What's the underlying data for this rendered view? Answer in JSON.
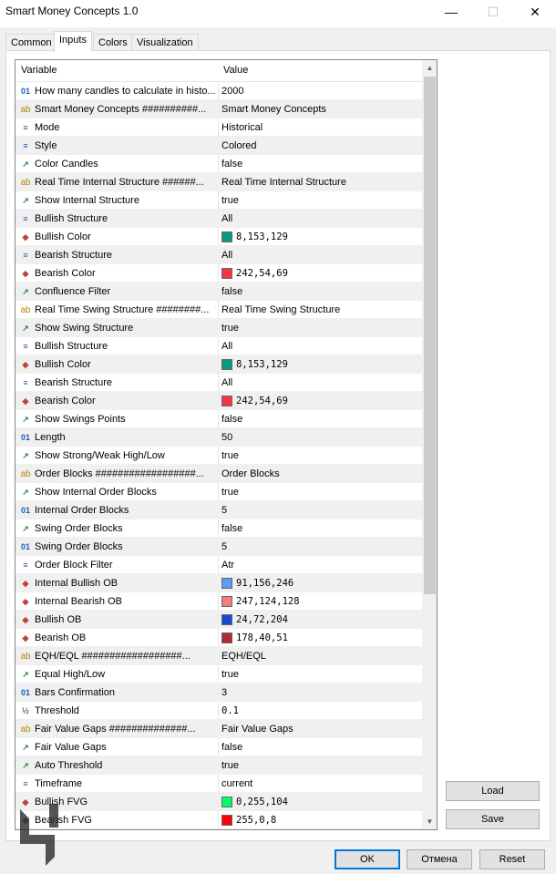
{
  "window": {
    "title": "Smart Money Concepts 1.0",
    "minimize": "—",
    "maximize": "☐",
    "close": "✕"
  },
  "tabs": [
    "Common",
    "Inputs",
    "Colors",
    "Visualization"
  ],
  "grid": {
    "col_variable": "Variable",
    "col_value": "Value",
    "rows": [
      {
        "icon": "01",
        "type": "num",
        "name": "How many candles to calculate in histo...",
        "value": "2000"
      },
      {
        "icon": "ab",
        "type": "str",
        "name": "Smart Money Concepts ##########...",
        "value": "Smart Money Concepts"
      },
      {
        "icon": "≡",
        "type": "enum",
        "name": "Mode",
        "value": "Historical"
      },
      {
        "icon": "≡",
        "type": "enum",
        "name": "Style",
        "value": "Colored"
      },
      {
        "icon": "↗",
        "type": "bool",
        "name": "Color Candles",
        "value": "false"
      },
      {
        "icon": "ab",
        "type": "str",
        "name": "Real Time Internal Structure ######...",
        "value": "Real Time Internal Structure"
      },
      {
        "icon": "↗",
        "type": "bool",
        "name": "Show Internal Structure",
        "value": "true"
      },
      {
        "icon": "≡",
        "type": "enum",
        "name": "Bullish Structure",
        "value": "All"
      },
      {
        "icon": "◆",
        "type": "color",
        "name": "Bullish Color",
        "value": "8,153,129",
        "swatch": "#089981"
      },
      {
        "icon": "≡",
        "type": "enum",
        "name": "Bearish Structure",
        "value": "All"
      },
      {
        "icon": "◆",
        "type": "color",
        "name": "Bearish Color",
        "value": "242,54,69",
        "swatch": "#f23645"
      },
      {
        "icon": "↗",
        "type": "bool",
        "name": "Confluence Filter",
        "value": "false"
      },
      {
        "icon": "ab",
        "type": "str",
        "name": "Real Time Swing Structure ########...",
        "value": "Real Time Swing Structure"
      },
      {
        "icon": "↗",
        "type": "bool",
        "name": "Show Swing Structure",
        "value": "true"
      },
      {
        "icon": "≡",
        "type": "enum",
        "name": "Bullish Structure",
        "value": "All"
      },
      {
        "icon": "◆",
        "type": "color",
        "name": "Bullish Color",
        "value": "8,153,129",
        "swatch": "#089981"
      },
      {
        "icon": "≡",
        "type": "enum",
        "name": "Bearish Structure",
        "value": "All"
      },
      {
        "icon": "◆",
        "type": "color",
        "name": "Bearish Color",
        "value": "242,54,69",
        "swatch": "#f23645"
      },
      {
        "icon": "↗",
        "type": "bool",
        "name": "Show Swings Points",
        "value": "false"
      },
      {
        "icon": "01",
        "type": "num",
        "name": "Length",
        "value": "50"
      },
      {
        "icon": "↗",
        "type": "bool",
        "name": "Show Strong/Weak High/Low",
        "value": "true"
      },
      {
        "icon": "ab",
        "type": "str",
        "name": "Order Blocks ##################...",
        "value": "Order Blocks"
      },
      {
        "icon": "↗",
        "type": "bool",
        "name": "Show Internal Order Blocks",
        "value": "true"
      },
      {
        "icon": "01",
        "type": "num",
        "name": "Internal Order Blocks",
        "value": "5"
      },
      {
        "icon": "↗",
        "type": "bool",
        "name": "Swing Order Blocks",
        "value": "false"
      },
      {
        "icon": "01",
        "type": "num",
        "name": "Swing Order Blocks",
        "value": "5"
      },
      {
        "icon": "≡",
        "type": "enum",
        "name": "Order Block Filter",
        "value": "Atr"
      },
      {
        "icon": "◆",
        "type": "color",
        "name": "Internal Bullish OB",
        "value": "91,156,246",
        "swatch": "#5b9cf6"
      },
      {
        "icon": "◆",
        "type": "color",
        "name": "Internal Bearish OB",
        "value": "247,124,128",
        "swatch": "#f77c80"
      },
      {
        "icon": "◆",
        "type": "color",
        "name": "Bullish OB",
        "value": "24,72,204",
        "swatch": "#1848cc"
      },
      {
        "icon": "◆",
        "type": "color",
        "name": "Bearish OB",
        "value": "178,40,51",
        "swatch": "#b22833"
      },
      {
        "icon": "ab",
        "type": "str",
        "name": "EQH/EQL ##################...",
        "value": "EQH/EQL"
      },
      {
        "icon": "↗",
        "type": "bool",
        "name": "Equal High/Low",
        "value": "true"
      },
      {
        "icon": "01",
        "type": "num",
        "name": "Bars Confirmation",
        "value": "3"
      },
      {
        "icon": "½",
        "type": "frac",
        "name": "Threshold",
        "value": "0.1"
      },
      {
        "icon": "ab",
        "type": "str",
        "name": "Fair Value Gaps ##############...",
        "value": "Fair Value Gaps"
      },
      {
        "icon": "↗",
        "type": "bool",
        "name": "Fair Value Gaps",
        "value": "false"
      },
      {
        "icon": "↗",
        "type": "bool",
        "name": "Auto Threshold",
        "value": "true"
      },
      {
        "icon": "≡",
        "type": "enum",
        "name": "Timeframe",
        "value": "current"
      },
      {
        "icon": "◆",
        "type": "color",
        "name": "Bullish FVG",
        "value": "0,255,104",
        "swatch": "#00ff68"
      },
      {
        "icon": "◆",
        "type": "color",
        "name": "Bearish FVG",
        "value": "255,0,8",
        "swatch": "#ff0008"
      }
    ]
  },
  "side_buttons": {
    "load": "Load",
    "save": "Save"
  },
  "footer_buttons": {
    "ok": "OK",
    "cancel": "Отмена",
    "reset": "Reset"
  }
}
